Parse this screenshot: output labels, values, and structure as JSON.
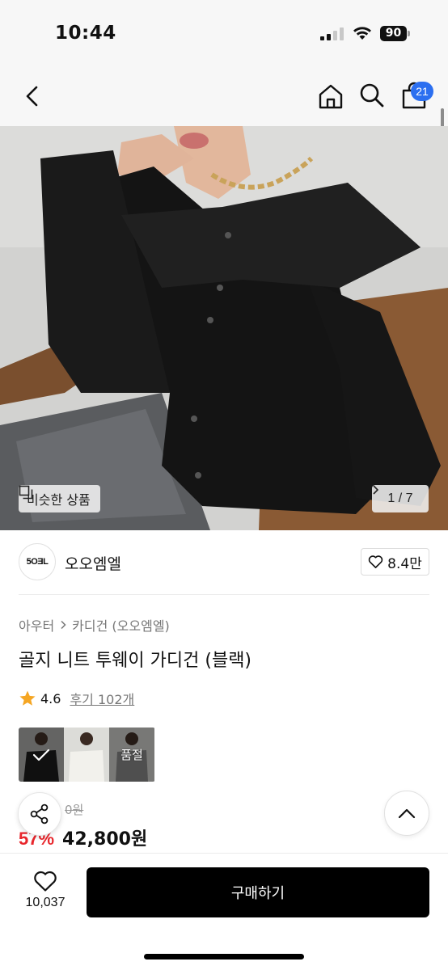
{
  "status_bar": {
    "time": "10:44",
    "battery": "90"
  },
  "nav": {
    "cart_count": "21"
  },
  "hero": {
    "similar_label": "비슷한 상품",
    "page_indicator": "1 / 7"
  },
  "brand": {
    "logo_text": "5OƎL",
    "name": "오오엠엘",
    "likes": "8.4만"
  },
  "breadcrumb": {
    "category": "아우터",
    "subcategory": "카디건 (오오엠엘)"
  },
  "product": {
    "title": "골지 니트 투웨이 가디건 (블랙)",
    "rating": "4.6",
    "reviews_label": "후기 102개",
    "options_soldout_label": "품절",
    "original_price": "0원",
    "discount": "57%",
    "sale_price": "42,800원"
  },
  "bottom_bar": {
    "wish_count": "10,037",
    "buy_label": "구매하기"
  },
  "colors": {
    "accent_blue": "#2b6ff0",
    "discount_red": "#e8262c",
    "star": "#f5a623",
    "buy_button": "#000000"
  }
}
